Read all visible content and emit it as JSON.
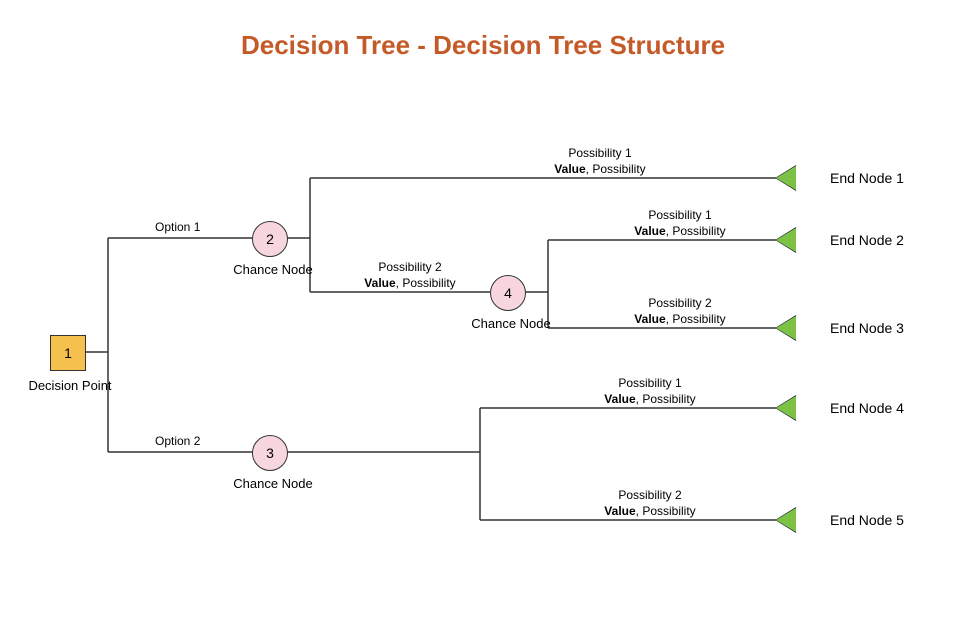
{
  "title": "Decision Tree - Decision Tree Structure",
  "decision": {
    "id": "1",
    "label": "Decision Point"
  },
  "options": {
    "opt1": "Option 1",
    "opt2": "Option 2"
  },
  "chance_nodes": {
    "n2": {
      "id": "2",
      "label": "Chance Node"
    },
    "n3": {
      "id": "3",
      "label": "Chance Node"
    },
    "n4": {
      "id": "4",
      "label": "Chance Node"
    }
  },
  "branch_labels": {
    "poss1": "Possibility 1",
    "poss2": "Possibility 2",
    "value": "Value",
    "poss": ", Possibility"
  },
  "end_nodes": {
    "e1": "End Node 1",
    "e2": "End Node 2",
    "e3": "End Node 3",
    "e4": "End Node 4",
    "e5": "End Node 5"
  }
}
